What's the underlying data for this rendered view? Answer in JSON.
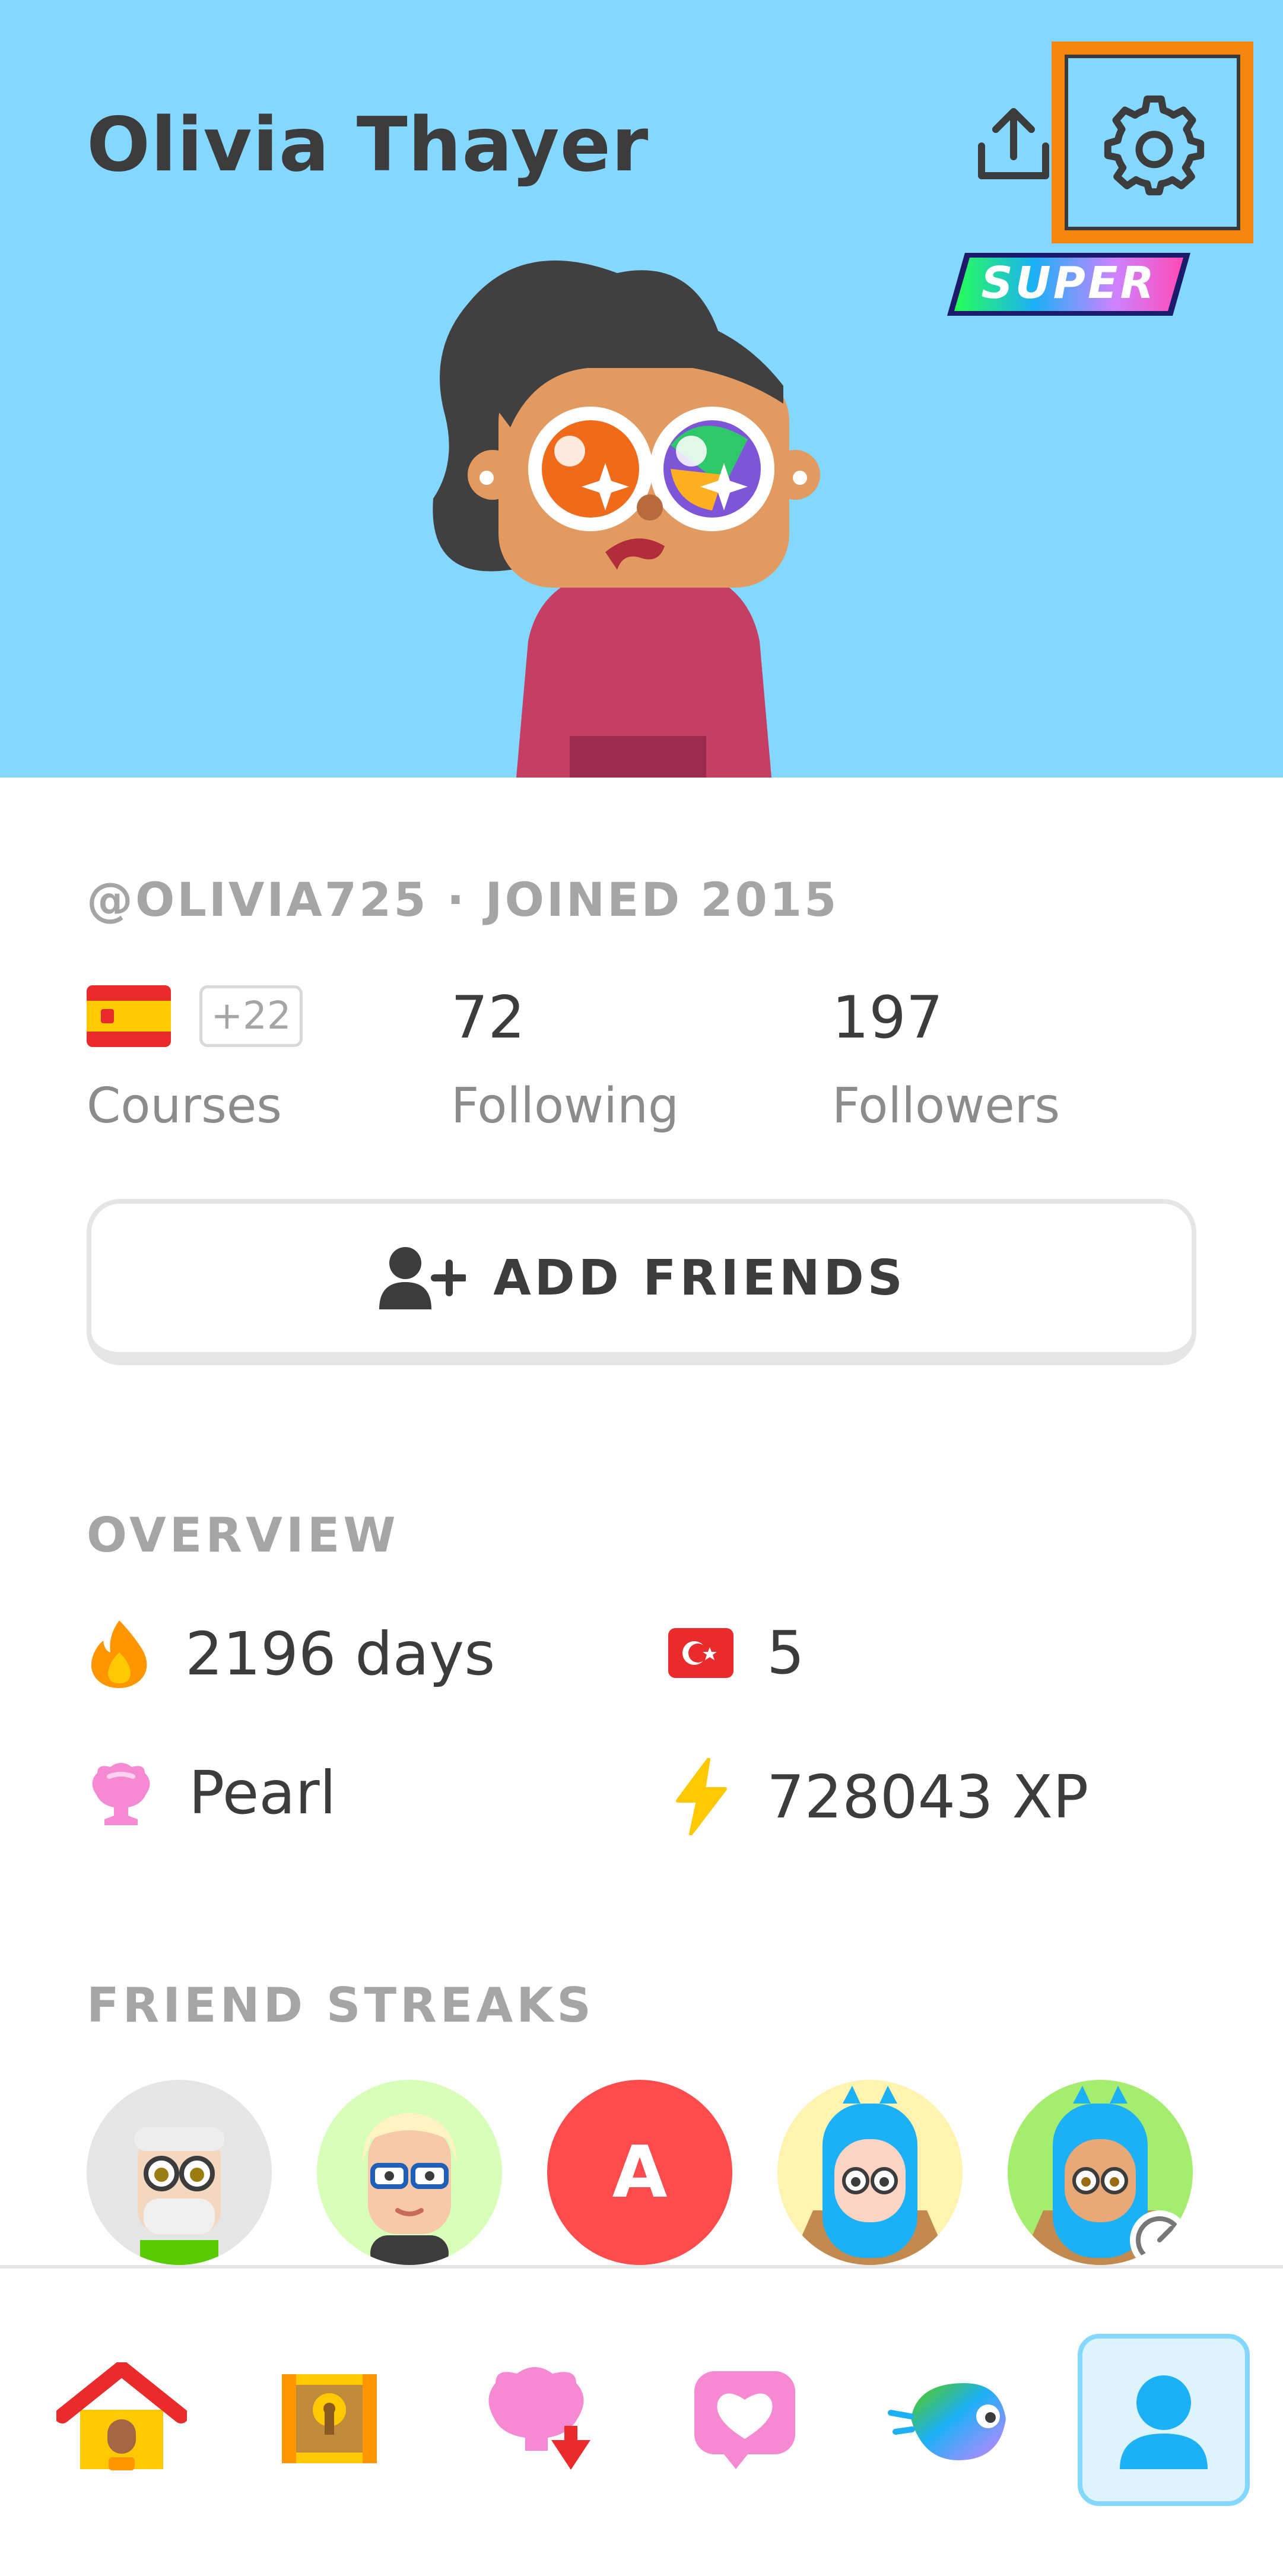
{
  "header": {
    "name": "Olivia Thayer",
    "badge": "SUPER",
    "bg_color": "#84d8ff"
  },
  "profile": {
    "handle_line": "@OLIVIA725 · JOINED 2015",
    "courses_more": "+22",
    "courses_label": "Courses",
    "following_count": "72",
    "following_label": "Following",
    "followers_count": "197",
    "followers_label": "Followers",
    "add_friends_label": "ADD FRIENDS"
  },
  "overview": {
    "title": "OVERVIEW",
    "streak": "2196 days",
    "flag_count": "5",
    "league": "Pearl",
    "xp": "728043 XP"
  },
  "friend_streaks": {
    "title": "FRIEND STREAKS",
    "letter_avatar": "A"
  },
  "icons": {
    "share": "share-icon",
    "settings": "gear-icon",
    "streak": "flame-icon",
    "league": "trophy-icon",
    "xp": "lightning-icon"
  },
  "colors": {
    "accent_orange": "#f6860d",
    "text_dark": "#3c3c3c",
    "text_muted": "#a5a5a5",
    "flame": "#ff9600",
    "league_pearl": "#f58ad3",
    "xp_yellow": "#ffc800",
    "letter_avatar_bg": "#ff4b4b"
  }
}
